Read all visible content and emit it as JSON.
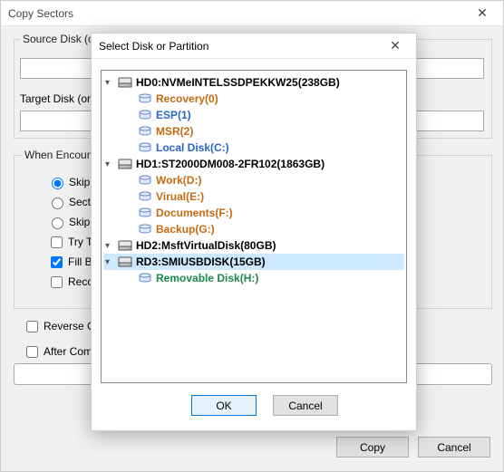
{
  "copy_sectors": {
    "title": "Copy Sectors",
    "source_label": "Source Disk (or",
    "target_label": "Target Disk (or",
    "when_label": "When Encount",
    "radio_skip": "Skip",
    "radio_sect": "Secto",
    "radio_skipt": "Skip T",
    "chk_tryt": "Try T",
    "chk_fill": "Fill Ba",
    "chk_reco": "Reco",
    "chk_reverse": "Reverse Co",
    "chk_after": "After Comp",
    "btn_copy": "Copy",
    "btn_cancel": "Cancel"
  },
  "select_disk": {
    "title": "Select Disk or Partition",
    "btn_ok": "OK",
    "btn_cancel": "Cancel",
    "tree": [
      {
        "type": "disk",
        "label": "HD0:NVMeINTELSSDPEKKW25(238GB)"
      },
      {
        "type": "part",
        "style": "orange",
        "label": "Recovery(0)"
      },
      {
        "type": "part",
        "style": "link",
        "label": "ESP(1)"
      },
      {
        "type": "part",
        "style": "orange",
        "label": "MSR(2)"
      },
      {
        "type": "part",
        "style": "link",
        "label": "Local Disk(C:)"
      },
      {
        "type": "disk",
        "label": "HD1:ST2000DM008-2FR102(1863GB)"
      },
      {
        "type": "part",
        "style": "orange",
        "label": "Work(D:)"
      },
      {
        "type": "part",
        "style": "orange",
        "label": "Virual(E:)"
      },
      {
        "type": "part",
        "style": "orange",
        "label": "Documents(F:)"
      },
      {
        "type": "part",
        "style": "orange",
        "label": "Backup(G:)"
      },
      {
        "type": "disk",
        "label": "HD2:MsftVirtualDisk(80GB)"
      },
      {
        "type": "disk",
        "selected": true,
        "label": "RD3:SMIUSBDISK(15GB)"
      },
      {
        "type": "part",
        "style": "green",
        "label": "Removable Disk(H:)"
      }
    ]
  }
}
